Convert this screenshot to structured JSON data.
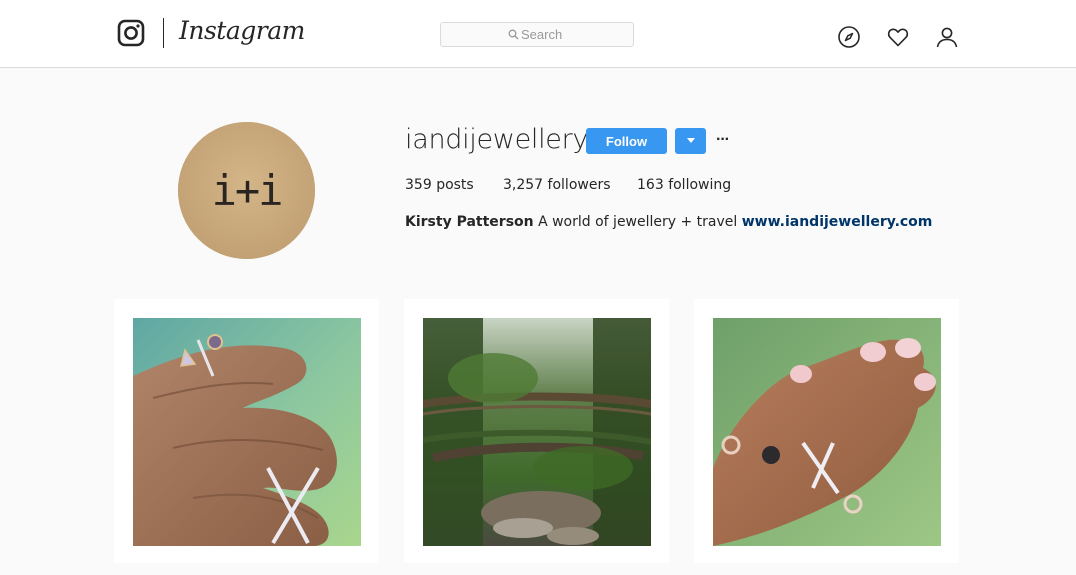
{
  "nav": {
    "brand": "Instagram",
    "search_placeholder": "Search",
    "icons": [
      "instagram-glyph-icon",
      "search-icon",
      "compass-icon",
      "heart-icon",
      "person-icon"
    ]
  },
  "profile": {
    "username": "iandijewellery",
    "avatar_text": "i+i",
    "follow_label": "Follow",
    "more_label": "···",
    "stats": {
      "posts_count": "359",
      "posts_label": "posts",
      "followers_count": "3,257",
      "followers_label": "followers",
      "following_count": "163",
      "following_label": "following"
    },
    "bio": {
      "name": "Kirsty Patterson",
      "text": "A world of jewellery + travel",
      "link": "www.iandijewellery.com"
    }
  },
  "colors": {
    "accent": "#3897f0",
    "link": "#003569",
    "text": "#262626",
    "background": "#fafafa",
    "border": "#dbdbdb"
  }
}
